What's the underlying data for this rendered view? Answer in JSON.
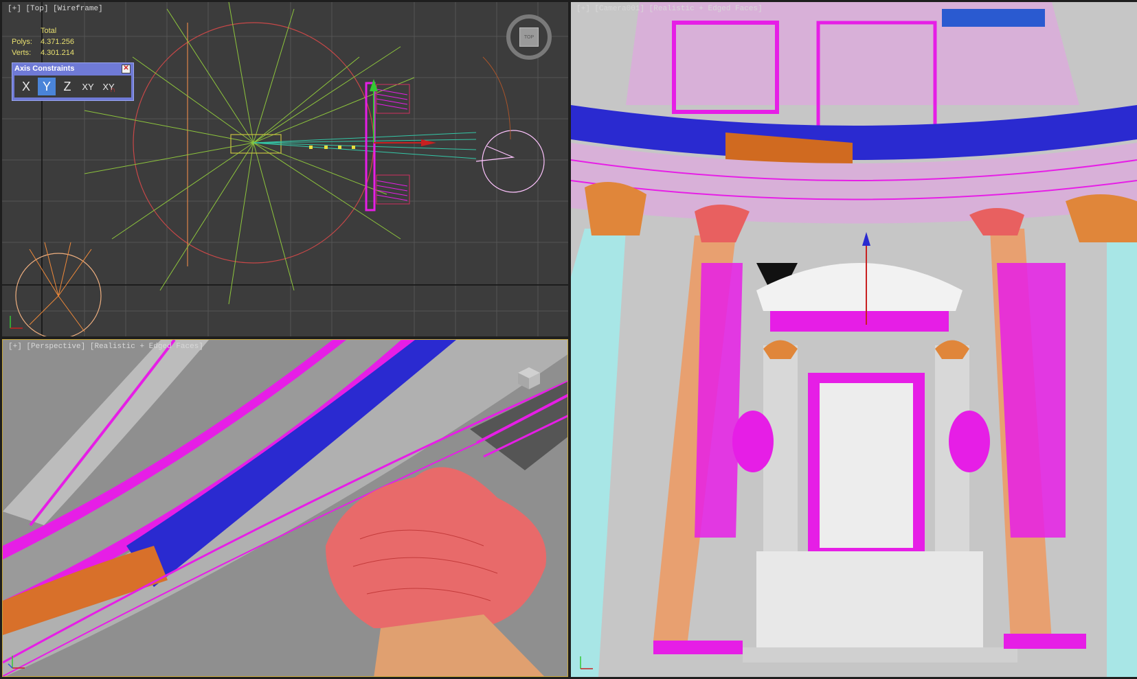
{
  "viewports": {
    "top": {
      "label_parts": [
        "[+]",
        "[Top]",
        "[Wireframe]"
      ],
      "viewcube_text": "TOP",
      "axis_y": "y",
      "stats": {
        "total_label": "Total",
        "polys_label": "Polys:",
        "polys_value": "4.371.256",
        "verts_label": "Verts:",
        "verts_value": "4.301.214"
      }
    },
    "perspective": {
      "label_parts": [
        "[+]",
        "[Perspective]",
        "[Realistic + Edged Faces]"
      ]
    },
    "camera": {
      "label_parts": [
        "[+]",
        "[Camera001]",
        "[Realistic + Edged Faces]"
      ]
    }
  },
  "axis_constraints": {
    "title": "Axis Constraints",
    "buttons": [
      "X",
      "Y",
      "Z",
      "XY",
      "XY"
    ],
    "active": "Y"
  },
  "colors": {
    "accent_active": "#4a84d8",
    "wire_magenta": "#e61ee6",
    "wire_blue": "#2a2ad0",
    "wire_orange": "#e07a30",
    "capital_red": "#e86060",
    "column_cyan": "#a8e6e6"
  },
  "icons": [
    "close-icon",
    "viewcube-icon",
    "axis-tripod-icon",
    "magnet-icon"
  ]
}
